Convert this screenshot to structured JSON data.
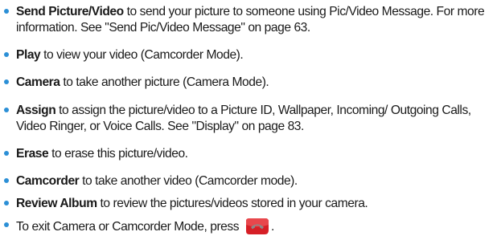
{
  "items": [
    {
      "term": "Send Picture/Video",
      "text": " to send your picture to someone using Pic/Video Message. For more information. See \"Send Pic/Video Message\" on page 63."
    },
    {
      "term": "Play",
      "text": " to view your video (Camcorder Mode)."
    },
    {
      "term": "Camera",
      "text": " to take another picture (Camera Mode)."
    },
    {
      "term": "Assign",
      "text": " to assign the picture/video to a Picture ID, Wallpaper, Incoming/ Outgoing Calls, Video Ringer, or Voice Calls. See \"Display\" on page 83."
    },
    {
      "term": "Erase",
      "text": " to erase this picture/video."
    },
    {
      "term": "Camcorder",
      "text": " to take another video (Camcorder mode)."
    },
    {
      "term": "Review Album",
      "text": " to review the pictures/videos stored in your camera."
    }
  ],
  "exit_note": {
    "text": "To exit Camera or Camcorder Mode, press",
    "suffix": ".",
    "icon": "end-key-icon"
  },
  "colors": {
    "bullet": "#2b8fd6",
    "end_key": "#d61f26"
  }
}
